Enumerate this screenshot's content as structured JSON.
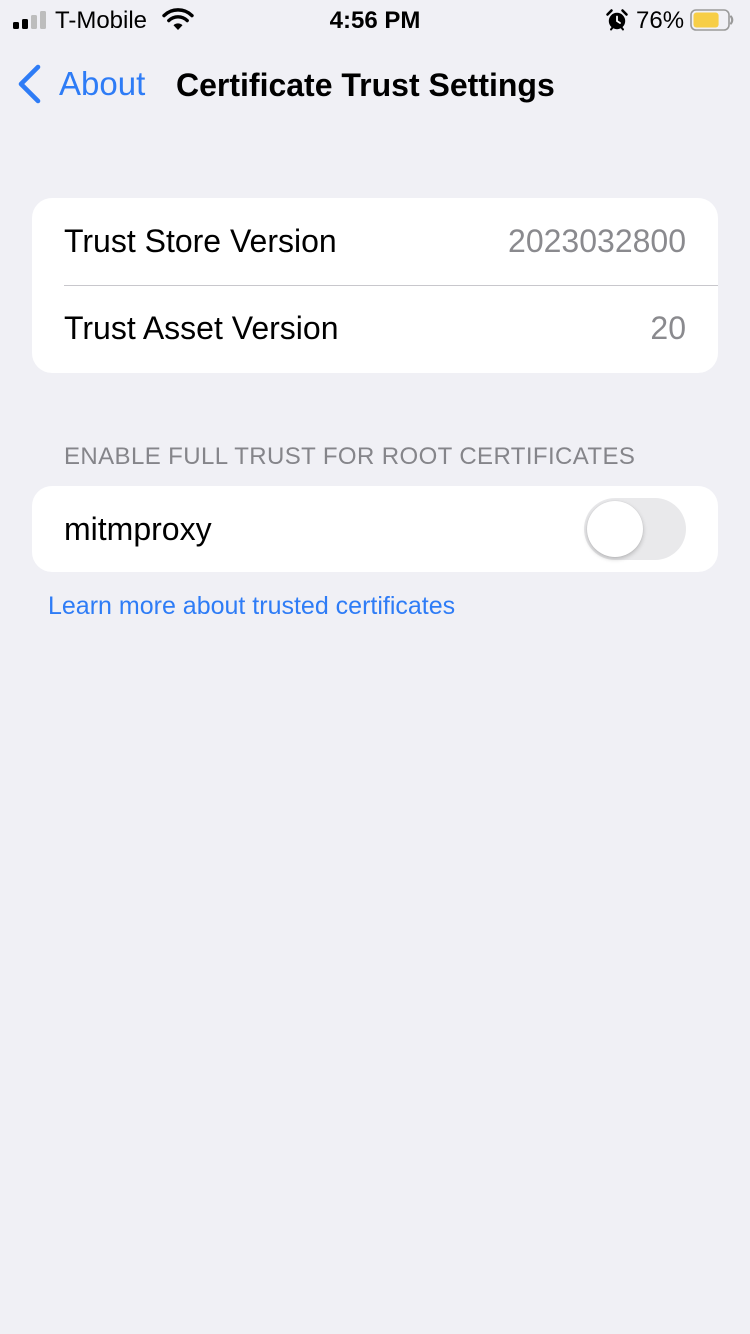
{
  "status_bar": {
    "carrier": "T-Mobile",
    "time": "4:56 PM",
    "battery_percent": "76%",
    "battery_level": 0.76,
    "signal_bars": 2,
    "signal_bars_total": 4,
    "icons": [
      "signal-icon",
      "wifi-icon",
      "alarm-icon",
      "battery-icon"
    ]
  },
  "nav": {
    "back_label": "About",
    "title": "Certificate Trust Settings"
  },
  "versions": [
    {
      "label": "Trust Store Version",
      "value": "2023032800"
    },
    {
      "label": "Trust Asset Version",
      "value": "20"
    }
  ],
  "trust_section": {
    "header": "ENABLE FULL TRUST FOR ROOT CERTIFICATES",
    "items": [
      {
        "label": "mitmproxy",
        "enabled": false
      }
    ]
  },
  "learn_more_link": "Learn more about trusted certificates",
  "colors": {
    "accent": "#2E7CF6",
    "background": "#F0F0F5",
    "secondary_text": "#8A8A8E",
    "battery_fill": "#F7CE46",
    "toggle_off": "#E9E9EB"
  }
}
